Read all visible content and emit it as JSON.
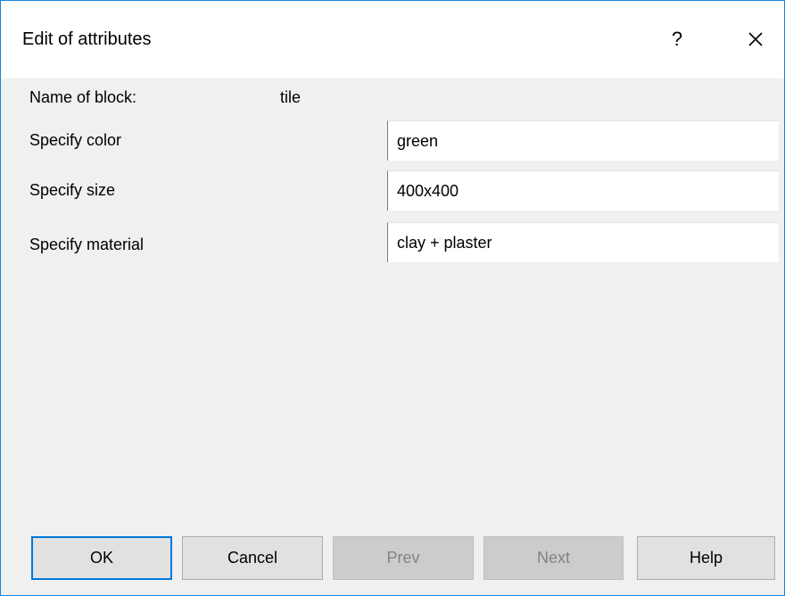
{
  "window": {
    "title": "Edit of attributes",
    "help_symbol": "?",
    "close_symbol": "×"
  },
  "block": {
    "label": "Name of block:",
    "value": "tile"
  },
  "attributes": [
    {
      "label": "Specify color",
      "value": "green"
    },
    {
      "label": "Specify size",
      "value": "400x400"
    },
    {
      "label": "Specify material",
      "value": "clay + plaster"
    }
  ],
  "buttons": {
    "ok": "OK",
    "cancel": "Cancel",
    "prev": "Prev",
    "next": "Next",
    "help": "Help"
  },
  "colors": {
    "accent_border": "#1883d7",
    "default_button_border": "#0078d7",
    "dialog_background": "#f0f0f0",
    "disabled_text": "#838383"
  }
}
